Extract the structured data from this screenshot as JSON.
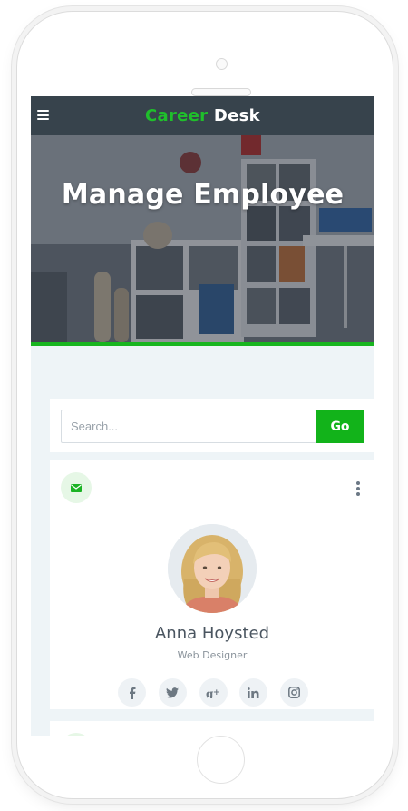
{
  "brand": {
    "part1": "Career",
    "part2": "Desk"
  },
  "hero": {
    "title": "Manage Employee"
  },
  "search": {
    "placeholder": "Search...",
    "value": "",
    "button_label": "Go"
  },
  "employee": {
    "name": "Anna Hoysted",
    "role": "Web Designer",
    "socials": [
      {
        "icon": "facebook-icon",
        "glyph": "f"
      },
      {
        "icon": "twitter-icon",
        "glyph": "t"
      },
      {
        "icon": "google-plus-icon",
        "glyph": "g+"
      },
      {
        "icon": "linkedin-icon",
        "glyph": "in"
      },
      {
        "icon": "instagram-icon",
        "glyph": "ig"
      }
    ]
  },
  "colors": {
    "accent": "#12b31a",
    "topbar": "#37434c",
    "screen_bg": "#eef4f7"
  }
}
